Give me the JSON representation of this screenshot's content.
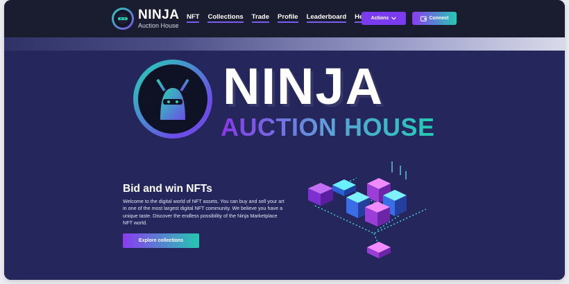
{
  "brand": {
    "name": "NINJA",
    "subtitle": "Auction House"
  },
  "nav": {
    "items": [
      {
        "label": "NFT"
      },
      {
        "label": "Collections"
      },
      {
        "label": "Trade"
      },
      {
        "label": "Profile"
      },
      {
        "label": "Leaderboard"
      },
      {
        "label": "Help"
      }
    ],
    "actions_label": "Actions",
    "connect_label": "Connect"
  },
  "hero": {
    "title": "NINJA",
    "subtitle": "AUCTION HOUSE",
    "headline": "Bid and win NFTs",
    "description": "Welcome to the digital world of NFT assets. You can buy and sell your art in one of the most largest digital NFT community. We believe you have a unique taste. Discover the endless possibility of the Ninja Marketplace NFT world.",
    "cta": "Explore collections"
  },
  "icons": {
    "logo": "ninja-logo-icon",
    "chevron": "chevron-down-icon",
    "wallet": "wallet-icon",
    "illustration": "server-network-illustration"
  },
  "colors": {
    "nav_bg": "#1a1c2f",
    "hero_bg": "#25275c",
    "accent_purple": "#7b3cf0",
    "accent_teal": "#26c9b4"
  }
}
